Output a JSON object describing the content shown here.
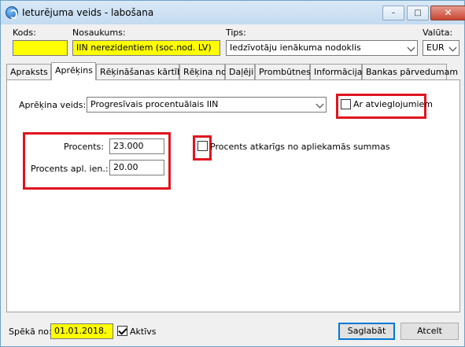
{
  "window": {
    "title": "Ieturējuma veids - labošana",
    "minimize_symbol": "–",
    "maximize_symbol": "□",
    "close_symbol": "✕"
  },
  "header": {
    "kods_label": "Kods:",
    "kods_value": "",
    "nosaukums_label": "Nosaukums:",
    "nosaukums_value": "IIN nerezidentiem (soc.nod. LV)",
    "tips_label": "Tips:",
    "tips_value": "Iedzīvotāju ienākuma nodoklis",
    "valuta_label": "Valūta:",
    "valuta_value": "EUR"
  },
  "tabs": [
    {
      "label": "Apraksts",
      "active": false
    },
    {
      "label": "Aprēķins",
      "active": true
    },
    {
      "label": "Rēķināšanas kārtība",
      "active": false
    },
    {
      "label": "Rēķina no",
      "active": false
    },
    {
      "label": "Daļēji",
      "active": false
    },
    {
      "label": "Prombūtnes",
      "active": false
    },
    {
      "label": "Informācija",
      "active": false
    },
    {
      "label": "Bankas pārvedumam",
      "active": false
    }
  ],
  "calc": {
    "veids_label": "Aprēķina veids:",
    "veids_value": "Progresīvais procentuālais IIN",
    "atvieglojumi_label": "Ar atvieglojumiem",
    "atvieglojumi_checked": false,
    "procents_label": "Procents:",
    "procents_value": "23.000",
    "procents_apl_label": "Procents apl. ien.:",
    "procents_apl_value": "20.00",
    "atkarigs_label": "Procents atkarīgs no apliekamās summas",
    "atkarigs_checked": false
  },
  "footer": {
    "speka_label": "Spēkā no:",
    "speka_value": "01.01.2018.",
    "aktivs_label": "Aktīvs",
    "aktivs_checked": true,
    "save_label": "Saglabāt",
    "cancel_label": "Atcelt"
  },
  "colors": {
    "highlight_yellow": "#ffff00",
    "annotation_red": "#e0141e",
    "default_button_border": "#0078d7"
  }
}
